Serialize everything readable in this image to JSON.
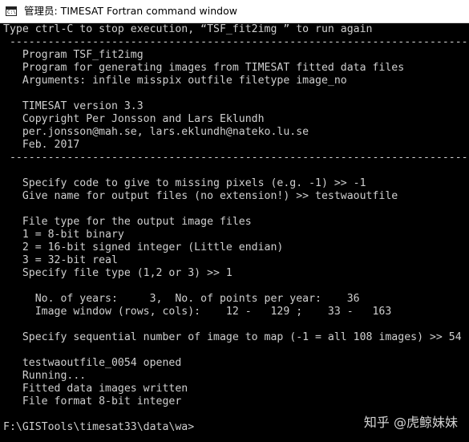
{
  "window": {
    "icon": "console-icon",
    "title": "管理员: TIMESAT Fortran command window"
  },
  "console": {
    "lines": [
      "Type ctrl-C to stop execution, “TSF_fit2img ” to run again",
      " ------------------------------------------------------------------------------",
      "   Program TSF_fit2img",
      "   Program for generating images from TIMESAT fitted data files",
      "   Arguments: infile misspix outfile filetype image_no",
      "",
      "   TIMESAT version 3.3",
      "   Copyright Per Jonsson and Lars Eklundh",
      "   per.jonsson@mah.se, lars.eklundh@nateko.lu.se",
      "   Feb. 2017",
      " ------------------------------------------------------------------------------",
      "",
      "   Specify code to give to missing pixels (e.g. -1) >> -1",
      "   Give name for output files (no extension!) >> testwaoutfile",
      "",
      "   File type for the output image files",
      "   1 = 8-bit binary",
      "   2 = 16-bit signed integer (Little endian)",
      "   3 = 32-bit real",
      "   Specify file type (1,2 or 3) >> 1",
      "",
      "     No. of years:     3,  No. of points per year:    36",
      "     Image window (rows, cols):    12 -   129 ;    33 -   163",
      "",
      "   Specify sequential number of image to map (-1 = all 108 images) >> 54",
      "",
      "   testwaoutfile_0054 opened",
      "   Running...",
      "   Fitted data images written",
      "   File format 8-bit integer",
      "",
      "F:\\GISTools\\timesat33\\data\\wa>"
    ]
  },
  "watermark": {
    "text": "知乎 @虎鲸妹妹"
  },
  "colors": {
    "background": "#000000",
    "text": "#cfcfcf",
    "titlebar": "#ffffff"
  }
}
